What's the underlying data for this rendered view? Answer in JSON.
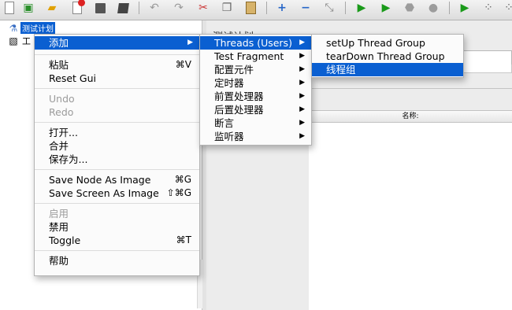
{
  "tree": {
    "root_label": "测试计划",
    "child_label": "工作台",
    "child_label_visible": "工"
  },
  "right_pane": {
    "title": "测试计划",
    "table_header": "名称:"
  },
  "context_menu": {
    "add": "添加",
    "paste": "粘贴",
    "paste_shortcut": "⌘V",
    "reset_gui": "Reset Gui",
    "undo": "Undo",
    "redo": "Redo",
    "open": "打开...",
    "merge": "合并",
    "save_as": "保存为...",
    "save_node_as_image": "Save Node As Image",
    "save_node_shortcut": "⌘G",
    "save_screen_as_image": "Save Screen As Image",
    "save_screen_shortcut": "⇧⌘G",
    "enable": "启用",
    "disable": "禁用",
    "toggle": "Toggle",
    "toggle_shortcut": "⌘T",
    "help": "帮助"
  },
  "add_submenu": {
    "threads": "Threads (Users)",
    "test_fragment": "Test Fragment",
    "config_element": "配置元件",
    "timer": "定时器",
    "pre_processor": "前置处理器",
    "post_processor": "后置处理器",
    "assertion": "断言",
    "listener": "监听器"
  },
  "threads_submenu": {
    "setup_thread_group": "setUp Thread Group",
    "teardown_thread_group": "tearDown Thread Group",
    "thread_group": "线程组"
  },
  "colors": {
    "selection": "#0a5fd1"
  }
}
